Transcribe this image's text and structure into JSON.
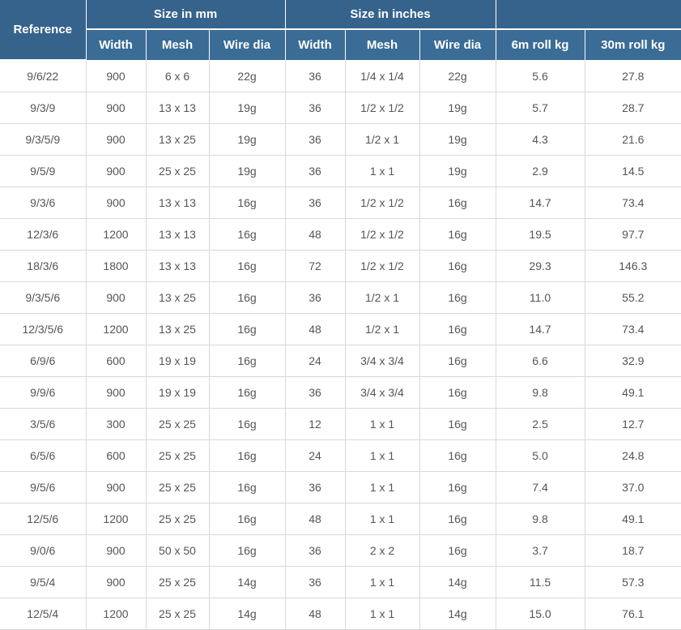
{
  "table": {
    "group_headers": {
      "reference": "Reference",
      "size_mm": "Size in mm",
      "size_in": "Size in inches",
      "blank": ""
    },
    "sub_headers": [
      "Width",
      "Mesh",
      "Wire dia",
      "Width",
      "Mesh",
      "Wire dia",
      "6m roll kg",
      "30m roll kg"
    ],
    "rows": [
      [
        "9/6/22",
        "900",
        "6 x 6",
        "22g",
        "36",
        "1/4 x 1/4",
        "22g",
        "5.6",
        "27.8"
      ],
      [
        "9/3/9",
        "900",
        "13 x 13",
        "19g",
        "36",
        "1/2 x 1/2",
        "19g",
        "5.7",
        "28.7"
      ],
      [
        "9/3/5/9",
        "900",
        "13 x 25",
        "19g",
        "36",
        "1/2 x 1",
        "19g",
        "4.3",
        "21.6"
      ],
      [
        "9/5/9",
        "900",
        "25 x 25",
        "19g",
        "36",
        "1 x 1",
        "19g",
        "2.9",
        "14.5"
      ],
      [
        "9/3/6",
        "900",
        "13 x 13",
        "16g",
        "36",
        "1/2 x 1/2",
        "16g",
        "14.7",
        "73.4"
      ],
      [
        "12/3/6",
        "1200",
        "13 x 13",
        "16g",
        "48",
        "1/2 x 1/2",
        "16g",
        "19.5",
        "97.7"
      ],
      [
        "18/3/6",
        "1800",
        "13 x 13",
        "16g",
        "72",
        "1/2 x 1/2",
        "16g",
        "29.3",
        "146.3"
      ],
      [
        "9/3/5/6",
        "900",
        "13 x 25",
        "16g",
        "36",
        "1/2 x 1",
        "16g",
        "11.0",
        "55.2"
      ],
      [
        "12/3/5/6",
        "1200",
        "13 x 25",
        "16g",
        "48",
        "1/2 x 1",
        "16g",
        "14.7",
        "73.4"
      ],
      [
        "6/9/6",
        "600",
        "19 x 19",
        "16g",
        "24",
        "3/4 x 3/4",
        "16g",
        "6.6",
        "32.9"
      ],
      [
        "9/9/6",
        "900",
        "19 x 19",
        "16g",
        "36",
        "3/4 x 3/4",
        "16g",
        "9.8",
        "49.1"
      ],
      [
        "3/5/6",
        "300",
        "25 x 25",
        "16g",
        "12",
        "1 x 1",
        "16g",
        "2.5",
        "12.7"
      ],
      [
        "6/5/6",
        "600",
        "25 x 25",
        "16g",
        "24",
        "1 x 1",
        "16g",
        "5.0",
        "24.8"
      ],
      [
        "9/5/6",
        "900",
        "25 x 25",
        "16g",
        "36",
        "1 x 1",
        "16g",
        "7.4",
        "37.0"
      ],
      [
        "12/5/6",
        "1200",
        "25 x 25",
        "16g",
        "48",
        "1 x 1",
        "16g",
        "9.8",
        "49.1"
      ],
      [
        "9/0/6",
        "900",
        "50 x 50",
        "16g",
        "36",
        "2 x 2",
        "16g",
        "3.7",
        "18.7"
      ],
      [
        "9/5/4",
        "900",
        "25 x 25",
        "14g",
        "36",
        "1 x 1",
        "14g",
        "11.5",
        "57.3"
      ],
      [
        "12/5/4",
        "1200",
        "25 x 25",
        "14g",
        "48",
        "1 x 1",
        "14g",
        "15.0",
        "76.1"
      ]
    ]
  },
  "colors": {
    "header_bg": "#36638c",
    "header_text": "#ffffff",
    "cell_text": "#555555",
    "grid_line": "#d9d9d9"
  }
}
